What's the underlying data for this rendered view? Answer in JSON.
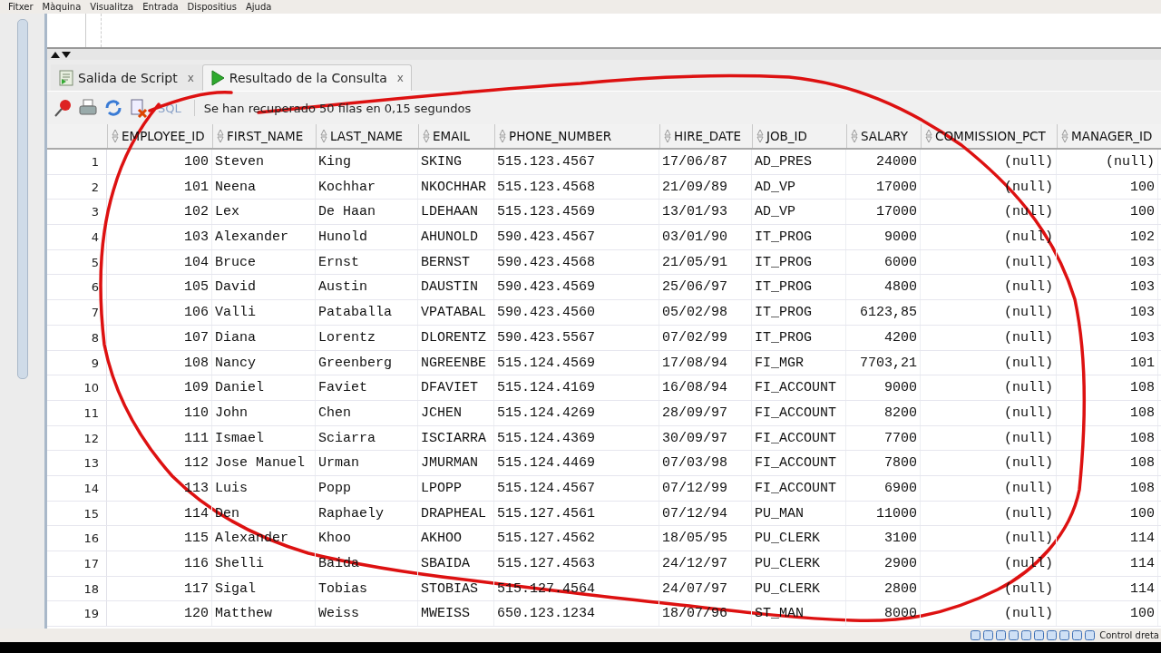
{
  "menu_bar": [
    "Fitxer",
    "Màquina",
    "Visualitza",
    "Entrada",
    "Dispositius",
    "Ajuda"
  ],
  "tabs": [
    {
      "label": "Salida de Script",
      "selected": false,
      "close": "x"
    },
    {
      "label": "Resultado de la Consulta",
      "selected": true,
      "close": "x"
    }
  ],
  "toolbar": {
    "sql_label": "SQL",
    "message": "Se han recuperado 50 filas en 0,15 segundos"
  },
  "table": {
    "columns": [
      {
        "label": "EMPLOYEE_ID",
        "kind": "number"
      },
      {
        "label": "FIRST_NAME",
        "kind": "text"
      },
      {
        "label": "LAST_NAME",
        "kind": "text"
      },
      {
        "label": "EMAIL",
        "kind": "text"
      },
      {
        "label": "PHONE_NUMBER",
        "kind": "text"
      },
      {
        "label": "HIRE_DATE",
        "kind": "text"
      },
      {
        "label": "JOB_ID",
        "kind": "text"
      },
      {
        "label": "SALARY",
        "kind": "number"
      },
      {
        "label": "COMMISSION_PCT",
        "kind": "number"
      },
      {
        "label": "MANAGER_ID",
        "kind": "number"
      }
    ],
    "rows": [
      {
        "number": "1",
        "cells": [
          "100",
          "Steven",
          "King",
          "SKING",
          "515.123.4567",
          "17/06/87",
          "AD_PRES",
          "24000",
          "(null)",
          "(null)"
        ]
      },
      {
        "number": "2",
        "cells": [
          "101",
          "Neena",
          "Kochhar",
          "NKOCHHAR",
          "515.123.4568",
          "21/09/89",
          "AD_VP",
          "17000",
          "(null)",
          "100"
        ]
      },
      {
        "number": "3",
        "cells": [
          "102",
          "Lex",
          "De Haan",
          "LDEHAAN",
          "515.123.4569",
          "13/01/93",
          "AD_VP",
          "17000",
          "(null)",
          "100"
        ]
      },
      {
        "number": "4",
        "cells": [
          "103",
          "Alexander",
          "Hunold",
          "AHUNOLD",
          "590.423.4567",
          "03/01/90",
          "IT_PROG",
          "9000",
          "(null)",
          "102"
        ]
      },
      {
        "number": "5",
        "cells": [
          "104",
          "Bruce",
          "Ernst",
          "BERNST",
          "590.423.4568",
          "21/05/91",
          "IT_PROG",
          "6000",
          "(null)",
          "103"
        ]
      },
      {
        "number": "6",
        "cells": [
          "105",
          "David",
          "Austin",
          "DAUSTIN",
          "590.423.4569",
          "25/06/97",
          "IT_PROG",
          "4800",
          "(null)",
          "103"
        ]
      },
      {
        "number": "7",
        "cells": [
          "106",
          "Valli",
          "Pataballa",
          "VPATABAL",
          "590.423.4560",
          "05/02/98",
          "IT_PROG",
          "6123,85",
          "(null)",
          "103"
        ]
      },
      {
        "number": "8",
        "cells": [
          "107",
          "Diana",
          "Lorentz",
          "DLORENTZ",
          "590.423.5567",
          "07/02/99",
          "IT_PROG",
          "4200",
          "(null)",
          "103"
        ]
      },
      {
        "number": "9",
        "cells": [
          "108",
          "Nancy",
          "Greenberg",
          "NGREENBE",
          "515.124.4569",
          "17/08/94",
          "FI_MGR",
          "7703,21",
          "(null)",
          "101"
        ]
      },
      {
        "number": "10",
        "cells": [
          "109",
          "Daniel",
          "Faviet",
          "DFAVIET",
          "515.124.4169",
          "16/08/94",
          "FI_ACCOUNT",
          "9000",
          "(null)",
          "108"
        ]
      },
      {
        "number": "11",
        "cells": [
          "110",
          "John",
          "Chen",
          "JCHEN",
          "515.124.4269",
          "28/09/97",
          "FI_ACCOUNT",
          "8200",
          "(null)",
          "108"
        ]
      },
      {
        "number": "12",
        "cells": [
          "111",
          "Ismael",
          "Sciarra",
          "ISCIARRA",
          "515.124.4369",
          "30/09/97",
          "FI_ACCOUNT",
          "7700",
          "(null)",
          "108"
        ]
      },
      {
        "number": "13",
        "cells": [
          "112",
          "Jose Manuel",
          "Urman",
          "JMURMAN",
          "515.124.4469",
          "07/03/98",
          "FI_ACCOUNT",
          "7800",
          "(null)",
          "108"
        ]
      },
      {
        "number": "14",
        "cells": [
          "113",
          "Luis",
          "Popp",
          "LPOPP",
          "515.124.4567",
          "07/12/99",
          "FI_ACCOUNT",
          "6900",
          "(null)",
          "108"
        ]
      },
      {
        "number": "15",
        "cells": [
          "114",
          "Den",
          "Raphaely",
          "DRAPHEAL",
          "515.127.4561",
          "07/12/94",
          "PU_MAN",
          "11000",
          "(null)",
          "100"
        ]
      },
      {
        "number": "16",
        "cells": [
          "115",
          "Alexander",
          "Khoo",
          "AKHOO",
          "515.127.4562",
          "18/05/95",
          "PU_CLERK",
          "3100",
          "(null)",
          "114"
        ]
      },
      {
        "number": "17",
        "cells": [
          "116",
          "Shelli",
          "Baida",
          "SBAIDA",
          "515.127.4563",
          "24/12/97",
          "PU_CLERK",
          "2900",
          "(null)",
          "114"
        ]
      },
      {
        "number": "18",
        "cells": [
          "117",
          "Sigal",
          "Tobias",
          "STOBIAS",
          "515.127.4564",
          "24/07/97",
          "PU_CLERK",
          "2800",
          "(null)",
          "114"
        ]
      },
      {
        "number": "19",
        "cells": [
          "120",
          "Matthew",
          "Weiss",
          "MWEISS",
          "650.123.1234",
          "18/07/96",
          "ST_MAN",
          "8000",
          "(null)",
          "100"
        ]
      }
    ]
  },
  "status_bar": {
    "host_key": "Control dreta"
  }
}
